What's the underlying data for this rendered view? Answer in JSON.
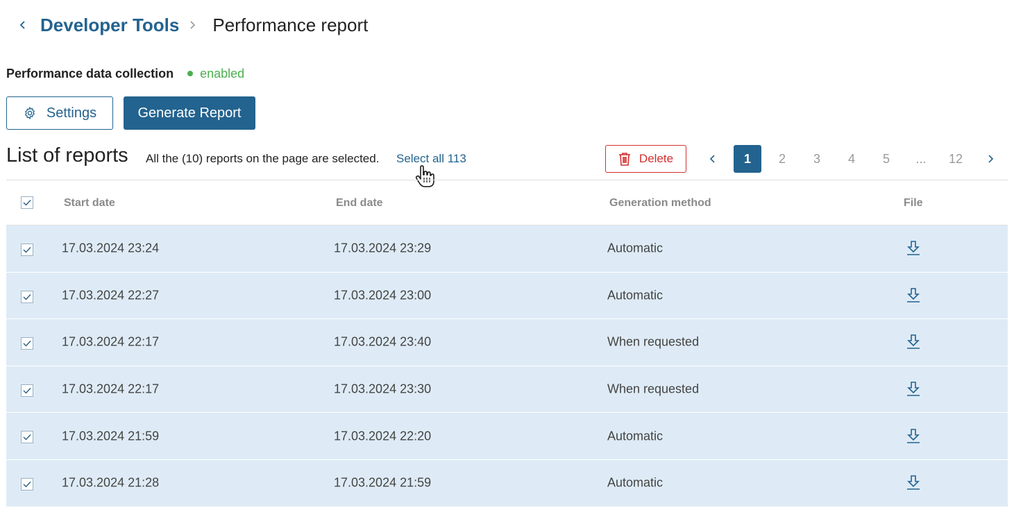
{
  "breadcrumb": {
    "parent": "Developer Tools",
    "current": "Performance report"
  },
  "status": {
    "label": "Performance data collection",
    "value": "enabled",
    "color": "#4caf50"
  },
  "buttons": {
    "settings": "Settings",
    "generate": "Generate Report",
    "delete": "Delete"
  },
  "list": {
    "title": "List of reports",
    "selection_note": "All the (10) reports on the page are selected.",
    "select_all": "Select all 113"
  },
  "pagination": {
    "pages": [
      "1",
      "2",
      "3",
      "4",
      "5",
      "...",
      "12"
    ],
    "current": "1"
  },
  "table": {
    "columns": [
      "Start date",
      "End date",
      "Generation method",
      "File"
    ],
    "rows": [
      {
        "start": "17.03.2024 23:24",
        "end": "17.03.2024 23:29",
        "method": "Automatic"
      },
      {
        "start": "17.03.2024 22:27",
        "end": "17.03.2024 23:00",
        "method": "Automatic"
      },
      {
        "start": "17.03.2024 22:17",
        "end": "17.03.2024 23:40",
        "method": "When requested"
      },
      {
        "start": "17.03.2024 22:17",
        "end": "17.03.2024 23:30",
        "method": "When requested"
      },
      {
        "start": "17.03.2024 21:59",
        "end": "17.03.2024 22:20",
        "method": "Automatic"
      },
      {
        "start": "17.03.2024 21:28",
        "end": "17.03.2024 21:59",
        "method": "Automatic"
      }
    ]
  },
  "colors": {
    "accent": "#23638f",
    "danger": "#d32f2f",
    "row_selected": "#deebf6",
    "success": "#4caf50"
  },
  "icons": [
    "chevron-left-icon",
    "chevron-right-icon",
    "gear-icon",
    "trash-icon",
    "download-icon",
    "checkbox-checked-icon",
    "hand-cursor-icon"
  ]
}
